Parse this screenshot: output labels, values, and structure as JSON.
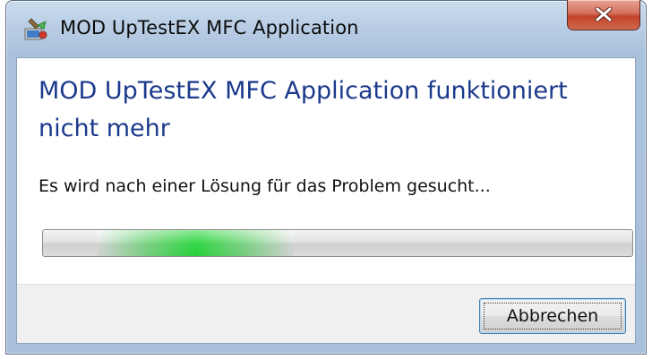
{
  "window": {
    "title": "MOD UpTestEX MFC Application",
    "icon": "application-icon"
  },
  "titlebar": {
    "close_icon": "close-icon"
  },
  "dialog": {
    "main_instruction": "MOD UpTestEX MFC Application funktioniert nicht mehr",
    "content": "Es wird nach einer Lösung für das Problem gesucht...",
    "progress_state": "indeterminate"
  },
  "footer": {
    "cancel_label": "Abbrechen"
  },
  "colors": {
    "main_instruction": "#1c3a8c",
    "progress_glow": "#21d634",
    "close_button": "#c2422b"
  }
}
